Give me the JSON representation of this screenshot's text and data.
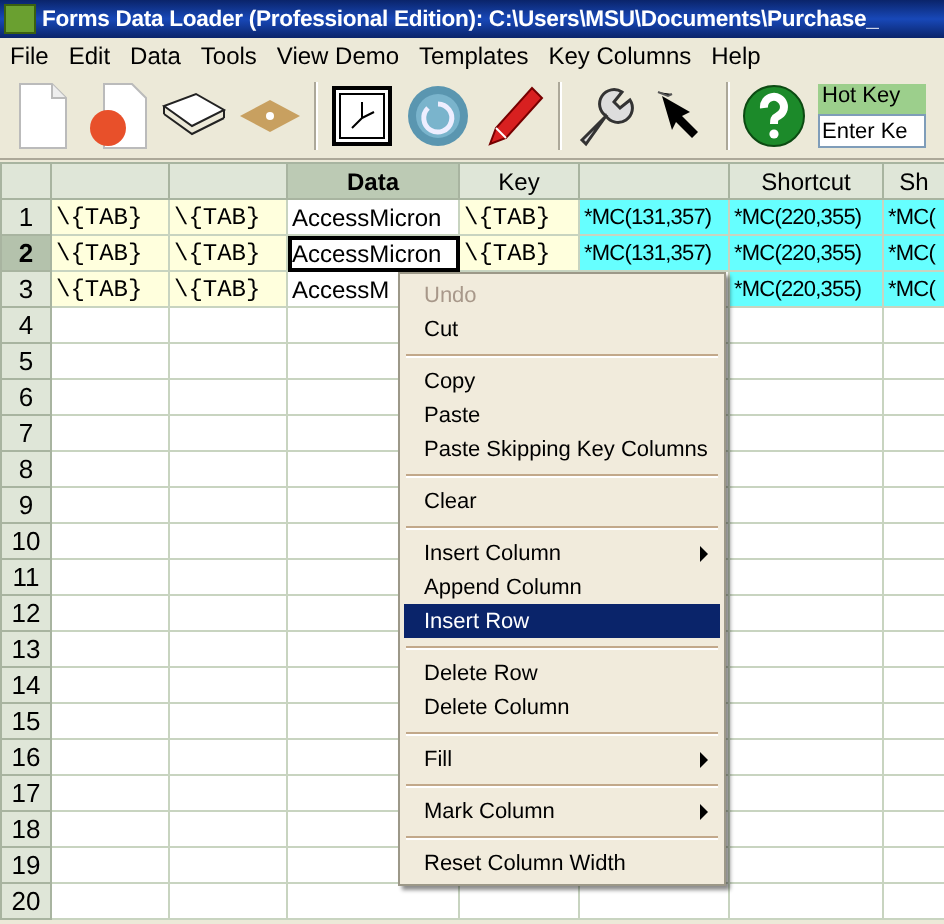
{
  "window": {
    "title": "Forms Data Loader (Professional Edition): C:\\Users\\MSU\\Documents\\Purchase_"
  },
  "menu_bar": [
    "File",
    "Edit",
    "Data",
    "Tools",
    "View Demo",
    "Templates",
    "Key Columns",
    "Help"
  ],
  "toolbar": {
    "hot_key": {
      "label": "Hot Key",
      "placeholder": "Enter Ke"
    }
  },
  "grid": {
    "columns": [
      {
        "kind": "tab",
        "selected": false
      },
      {
        "kind": "tab",
        "selected": false
      },
      {
        "label": "Data",
        "kind": "data",
        "selected": true
      },
      {
        "label": "Key",
        "kind": "tab",
        "selected": false
      },
      {
        "kind": "macro",
        "selected": false
      },
      {
        "label": "Shortcut",
        "kind": "macro",
        "selected": false
      },
      {
        "label": "Sh",
        "kind": "macro",
        "selected": false
      }
    ],
    "rows": [
      {
        "header": "1",
        "selected": false,
        "cells": [
          {
            "text": "\\{TAB}",
            "selected": false
          },
          {
            "text": "\\{TAB}",
            "selected": false
          },
          {
            "text": "AccessMicron",
            "selected": false
          },
          {
            "text": "\\{TAB}",
            "selected": false
          },
          {
            "text": "*MC(131,357)",
            "selected": false
          },
          {
            "text": "*MC(220,355)",
            "selected": false
          },
          {
            "text": "*MC(",
            "selected": false
          }
        ]
      },
      {
        "header": "2",
        "selected": true,
        "cells": [
          {
            "text": "\\{TAB}",
            "selected": false
          },
          {
            "text": "\\{TAB}",
            "selected": false
          },
          {
            "text": "AccessMicron",
            "selected": true
          },
          {
            "text": "\\{TAB}",
            "selected": false
          },
          {
            "text": "*MC(131,357)",
            "selected": false
          },
          {
            "text": "*MC(220,355)",
            "selected": false
          },
          {
            "text": "*MC(",
            "selected": false
          }
        ]
      },
      {
        "header": "3",
        "selected": false,
        "cells": [
          {
            "text": "\\{TAB}",
            "selected": false
          },
          {
            "text": "\\{TAB}",
            "selected": false
          },
          {
            "text": "AccessM",
            "selected": false
          },
          null,
          null,
          {
            "text": "*MC(220,355)",
            "selected": false
          },
          {
            "text": "*MC(",
            "selected": false
          }
        ]
      },
      {
        "header": "4",
        "selected": false
      },
      {
        "header": "5",
        "selected": false
      },
      {
        "header": "6",
        "selected": false
      },
      {
        "header": "7",
        "selected": false
      },
      {
        "header": "8",
        "selected": false
      },
      {
        "header": "9",
        "selected": false
      },
      {
        "header": "10",
        "selected": false
      },
      {
        "header": "11",
        "selected": false
      },
      {
        "header": "12",
        "selected": false
      },
      {
        "header": "13",
        "selected": false
      },
      {
        "header": "14",
        "selected": false
      },
      {
        "header": "15",
        "selected": false
      },
      {
        "header": "16",
        "selected": false
      },
      {
        "header": "17",
        "selected": false
      },
      {
        "header": "18",
        "selected": false
      },
      {
        "header": "19",
        "selected": false
      },
      {
        "header": "20",
        "selected": false
      }
    ]
  },
  "context_menu": [
    {
      "kind": "item",
      "label": "Undo",
      "disabled": true,
      "selected": false,
      "submenu": false
    },
    {
      "kind": "item",
      "label": "Cut",
      "disabled": false,
      "selected": false,
      "submenu": false
    },
    {
      "kind": "separator"
    },
    {
      "kind": "item",
      "label": "Copy",
      "disabled": false,
      "selected": false,
      "submenu": false
    },
    {
      "kind": "item",
      "label": "Paste",
      "disabled": false,
      "selected": false,
      "submenu": false
    },
    {
      "kind": "item",
      "label": "Paste Skipping Key Columns",
      "disabled": false,
      "selected": false,
      "submenu": false
    },
    {
      "kind": "separator"
    },
    {
      "kind": "item",
      "label": "Clear",
      "disabled": false,
      "selected": false,
      "submenu": false
    },
    {
      "kind": "separator"
    },
    {
      "kind": "item",
      "label": "Insert Column",
      "disabled": false,
      "selected": false,
      "submenu": true
    },
    {
      "kind": "item",
      "label": "Append Column",
      "disabled": false,
      "selected": false,
      "submenu": false
    },
    {
      "kind": "item",
      "label": "Insert Row",
      "disabled": false,
      "selected": true,
      "submenu": false
    },
    {
      "kind": "separator"
    },
    {
      "kind": "item",
      "label": "Delete Row",
      "disabled": false,
      "selected": false,
      "submenu": false
    },
    {
      "kind": "item",
      "label": "Delete Column",
      "disabled": false,
      "selected": false,
      "submenu": false
    },
    {
      "kind": "separator"
    },
    {
      "kind": "item",
      "label": "Fill",
      "disabled": false,
      "selected": false,
      "submenu": true
    },
    {
      "kind": "separator"
    },
    {
      "kind": "item",
      "label": "Mark Column",
      "disabled": false,
      "selected": false,
      "submenu": true
    },
    {
      "kind": "separator"
    },
    {
      "kind": "item",
      "label": "Reset Column Width",
      "disabled": false,
      "selected": false,
      "submenu": false
    }
  ]
}
